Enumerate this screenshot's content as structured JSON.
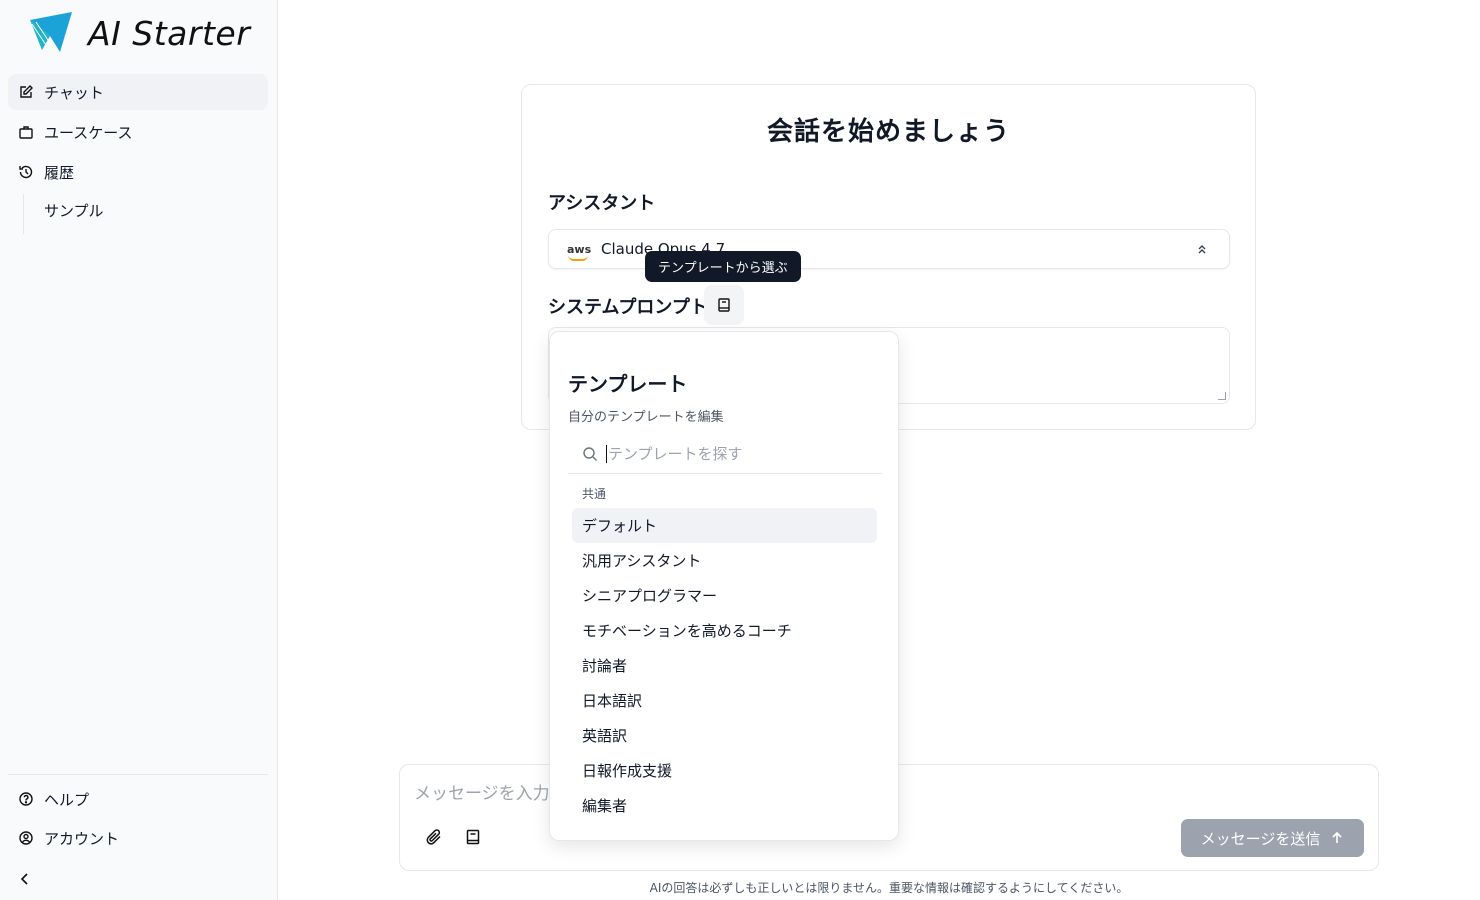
{
  "app": {
    "logo_text": "AI Starter"
  },
  "sidebar": {
    "items": [
      {
        "label": "チャット",
        "icon": "edit-icon",
        "active": true
      },
      {
        "label": "ユースケース",
        "icon": "briefcase-icon"
      },
      {
        "label": "履歴",
        "icon": "history-icon"
      }
    ],
    "history": [
      {
        "label": "サンプル"
      }
    ],
    "bottom": [
      {
        "label": "ヘルプ",
        "icon": "help-circle-icon"
      },
      {
        "label": "アカウント",
        "icon": "user-circle-icon"
      }
    ]
  },
  "main": {
    "title": "会話を始めましょう",
    "assistant_label": "アシスタント",
    "model": "Claude Opus 4.7",
    "model_provider": "aws",
    "system_prompt_label": "システムプロンプト",
    "template_tooltip": "テンプレートから選ぶ"
  },
  "popover": {
    "title": "テンプレート",
    "subtitle": "自分のテンプレートを編集",
    "search_placeholder": "テンプレートを探す",
    "group": "共通",
    "items": [
      "デフォルト",
      "汎用アシスタント",
      "シニアプログラマー",
      "モチベーションを高めるコーチ",
      "討論者",
      "日本語訳",
      "英語訳",
      "日報作成支援",
      "編集者"
    ],
    "selected_index": 0
  },
  "composer": {
    "placeholder": "メッセージを入力",
    "send_label": "メッセージを送信",
    "disclaimer": "AIの回答は必ずしも正しいとは限りません。重要な情報は確認するようにしてください。"
  },
  "colors": {
    "accent_blue": "#1ba3d8",
    "send_disabled": "#9ca3af"
  }
}
